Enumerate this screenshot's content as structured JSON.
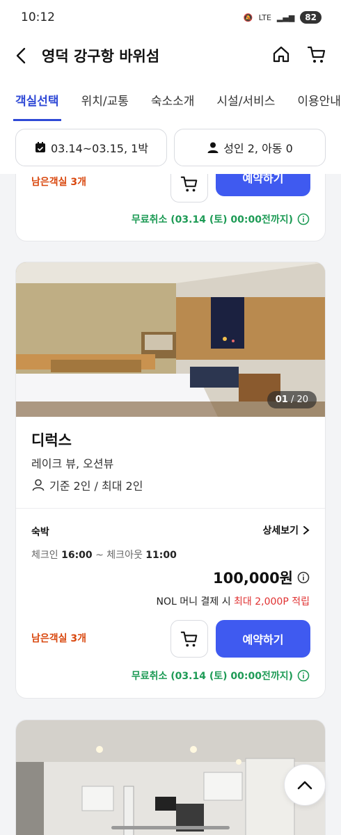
{
  "status_bar": {
    "time": "10:12",
    "network": "LTE",
    "battery": "82"
  },
  "header": {
    "title": "영덕 강구항 바위섬"
  },
  "tabs": [
    {
      "label": "객실선택",
      "active": true
    },
    {
      "label": "위치/교통"
    },
    {
      "label": "숙소소개"
    },
    {
      "label": "시설/서비스"
    },
    {
      "label": "이용안내"
    }
  ],
  "filters": {
    "dates": "03.14~03.15, 1박",
    "guests": "성인 2, 아동 0"
  },
  "top_card": {
    "remaining": "남은객실 3개",
    "book_label": "예약하기",
    "cancel": "무료취소 (03.14 (토) 00:00전까지)"
  },
  "room": {
    "photo_index": "01",
    "photo_total": "/ 20",
    "name": "디럭스",
    "view": "레이크 뷰, 오션뷰",
    "capacity": "기준 2인 / 최대 2인",
    "stay_type": "숙박",
    "detail_label": "상세보기",
    "checkin_label": "체크인",
    "checkin_time": "16:00",
    "checkout_label": "~ 체크아웃",
    "checkout_time": "11:00",
    "price": "100,000원",
    "reward_prefix": "NOL 머니 결제 시",
    "reward_highlight": "최대 2,000P 적립",
    "remaining": "남은객실 3개",
    "book_label": "예약하기",
    "cancel": "무료취소 (03.14 (토) 00:00전까지)"
  },
  "colors": {
    "accent": "#2f49d6",
    "book_button": "#3f5af0",
    "remaining": "#d9480f",
    "cancel": "#1e9b56",
    "highlight": "#e03131"
  }
}
